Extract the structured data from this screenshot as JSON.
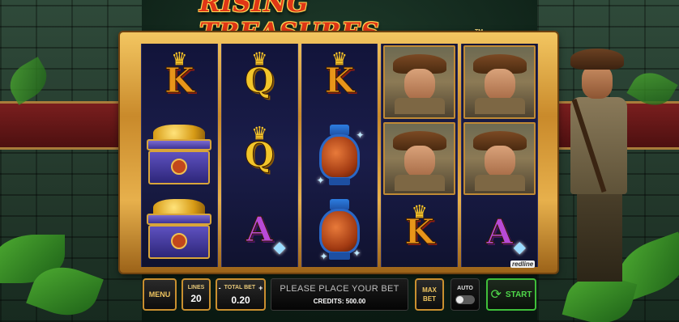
{
  "game": {
    "title": "RISING TREASURES",
    "trademark": "TM",
    "provider": "redline"
  },
  "reels": [
    [
      {
        "symbol": "K",
        "icon": "crown-icon"
      },
      {
        "symbol": "chest",
        "icon": "treasure-chest-icon"
      },
      {
        "symbol": "chest",
        "icon": "treasure-chest-icon"
      }
    ],
    [
      {
        "symbol": "Q",
        "icon": "crown-icon"
      },
      {
        "symbol": "Q",
        "icon": "crown-icon"
      },
      {
        "symbol": "A",
        "icon": "diamond-icon"
      }
    ],
    [
      {
        "symbol": "K",
        "icon": "crown-icon"
      },
      {
        "symbol": "vase",
        "icon": "vase-icon"
      },
      {
        "symbol": "vase",
        "icon": "vase-icon"
      }
    ],
    [
      {
        "symbol": "explorer",
        "icon": "explorer-icon"
      },
      {
        "symbol": "explorer",
        "icon": "explorer-icon"
      },
      {
        "symbol": "K",
        "icon": "crown-icon"
      }
    ],
    [
      {
        "symbol": "explorer",
        "icon": "explorer-icon"
      },
      {
        "symbol": "explorer",
        "icon": "explorer-icon"
      },
      {
        "symbol": "A",
        "icon": "diamond-icon"
      }
    ]
  ],
  "controls": {
    "menu_label": "MENU",
    "lines_label": "LINES",
    "lines_value": "20",
    "total_bet_minus": "-",
    "total_bet_label": "TOTAL BET",
    "total_bet_plus": "+",
    "total_bet_value": "0.20",
    "message": "PLEASE PLACE YOUR BET",
    "credits": "CREDITS: 500.00",
    "max_bet_line1": "MAX",
    "max_bet_line2": "BET",
    "auto_label": "AUTO",
    "start_label": "START"
  },
  "colors": {
    "frame_gold": "#e7b04c",
    "start_green": "#4fd84a",
    "button_gold": "#f1c660",
    "logo_red": "#e03616"
  }
}
